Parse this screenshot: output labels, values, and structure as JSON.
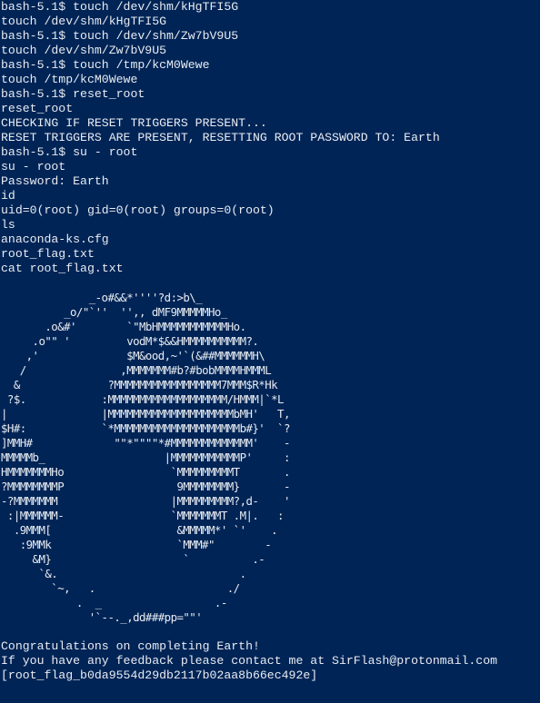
{
  "terminal": {
    "background": "#002456",
    "foreground": "#e8ecf2",
    "session_lines": [
      "bash-5.1$ touch /dev/shm/kHgTFI5G",
      "touch /dev/shm/kHgTFI5G",
      "bash-5.1$ touch /dev/shm/Zw7bV9U5",
      "touch /dev/shm/Zw7bV9U5",
      "bash-5.1$ touch /tmp/kcM0Wewe",
      "touch /tmp/kcM0Wewe",
      "bash-5.1$ reset_root",
      "reset_root",
      "CHECKING IF RESET TRIGGERS PRESENT...",
      "RESET TRIGGERS ARE PRESENT, RESETTING ROOT PASSWORD TO: Earth",
      "bash-5.1$ su - root",
      "su - root",
      "Password: Earth",
      "id",
      "uid=0(root) gid=0(root) groups=0(root)",
      "ls",
      "anaconda-ks.cfg",
      "root_flag.txt",
      "cat root_flag.txt"
    ],
    "ascii_art": [
      "",
      "              _-o#&&*''''?d:>b\\_",
      "          _o/\"`''  '',, dMF9MMMMMHo_",
      "       .o&#'        `\"MbHMMMMMMMMMMMHo.",
      "     .o\"\" '         vodM*$&&HMMMMMMMMMM?.",
      "    ,'              $M&ood,~'`(&##MMMMMMH\\",
      "   /               ,MMMMMMM#b?#bobMMMMHMMML",
      "  &              ?MMMMMMMMMMMMMMMMM7MMM$R*Hk",
      " ?$.            :MMMMMMMMMMMMMMMMMMM/HMMM|`*L",
      "|               |MMMMMMMMMMMMMMMMMMMMbMH'   T,",
      "$H#:            `*MMMMMMMMMMMMMMMMMMMMb#}'  `?",
      "]MMH#             \"\"*\"\"\"\"*#MMMMMMMMMMMMM'    -",
      "MMMMMb_                   |MMMMMMMMMMMP'     :",
      "HMMMMMMMHo                 `MMMMMMMMMT       .",
      "?MMMMMMMMP                  9MMMMMMMM}       -",
      "-?MMMMMMM                  |MMMMMMMMM?,d-    '",
      " :|MMMMMM-                 `MMMMMMMT .M|.   :",
      "  .9MMM[                    &MMMMM*' `'    .",
      "   :9MMk                    `MMM#\"        -",
      "     &M}                     `          .-",
      "      `&.                             .",
      "        `~,   .                     ./",
      "            .  _                  .-",
      "              '`--._,dd###pp=\"\"'"
    ],
    "closing_lines": [
      "Congratulations on completing Earth!",
      "If you have any feedback please contact me at SirFlash@protonmail.com",
      "[root_flag_b0da9554d29db2117b02aa8b66ec492e]"
    ]
  }
}
